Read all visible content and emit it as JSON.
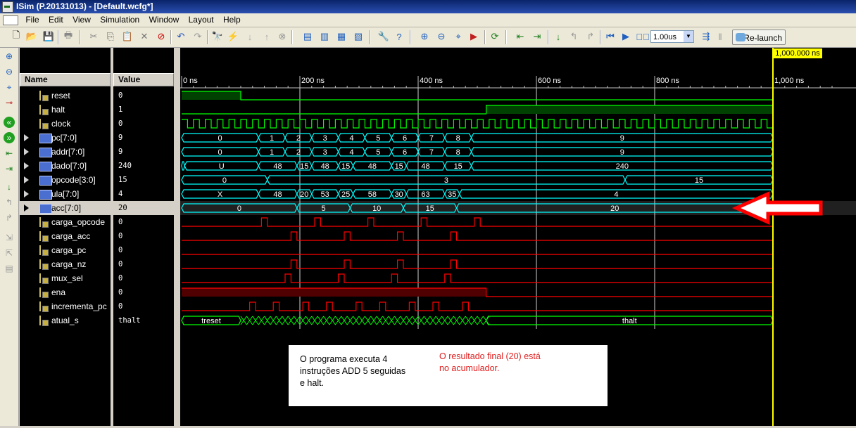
{
  "window": {
    "title": "ISim (P.20131013) - [Default.wcfg*]"
  },
  "menu": [
    "File",
    "Edit",
    "View",
    "Simulation",
    "Window",
    "Layout",
    "Help"
  ],
  "toolbar": {
    "run_time": "1.00us",
    "relaunch_label": "Re-launch"
  },
  "columns": {
    "name": "Name",
    "value": "Value"
  },
  "signals": [
    {
      "name": "reset",
      "value": "0",
      "kind": "bit",
      "expand": false
    },
    {
      "name": "halt",
      "value": "1",
      "kind": "bit",
      "expand": false
    },
    {
      "name": "clock",
      "value": "0",
      "kind": "bit",
      "expand": false
    },
    {
      "name": "pc[7:0]",
      "value": "9",
      "kind": "bus",
      "expand": true
    },
    {
      "name": "addr[7:0]",
      "value": "9",
      "kind": "bus",
      "expand": true
    },
    {
      "name": "dado[7:0]",
      "value": "240",
      "kind": "bus",
      "expand": true
    },
    {
      "name": "opcode[3:0]",
      "value": "15",
      "kind": "bus",
      "expand": true
    },
    {
      "name": "ula[7:0]",
      "value": "4",
      "kind": "bus",
      "expand": true
    },
    {
      "name": "acc[7:0]",
      "value": "20",
      "kind": "bus",
      "expand": true,
      "selected": true
    },
    {
      "name": "carga_opcode",
      "value": "0",
      "kind": "bit",
      "expand": false
    },
    {
      "name": "carga_acc",
      "value": "0",
      "kind": "bit",
      "expand": false
    },
    {
      "name": "carga_pc",
      "value": "0",
      "kind": "bit",
      "expand": false
    },
    {
      "name": "carga_nz",
      "value": "0",
      "kind": "bit",
      "expand": false
    },
    {
      "name": "mux_sel",
      "value": "0",
      "kind": "bit",
      "expand": false
    },
    {
      "name": "ena",
      "value": "0",
      "kind": "bit",
      "expand": false
    },
    {
      "name": "incrementa_pc",
      "value": "0",
      "kind": "bit",
      "expand": false
    },
    {
      "name": "atual_s",
      "value": "thalt",
      "kind": "bus",
      "expand": false
    }
  ],
  "timeline": {
    "ticks": [
      "0 ns",
      "200 ns",
      "400 ns",
      "600 ns",
      "800 ns",
      "1,000 ns"
    ],
    "cursor_label": "1,000.000 ns"
  },
  "waveforms": {
    "pc": [
      "0",
      "1",
      "2",
      "3",
      "4",
      "5",
      "6",
      "7",
      "8",
      "9"
    ],
    "addr": [
      "0",
      "1",
      "2",
      "3",
      "4",
      "5",
      "6",
      "7",
      "8",
      "9"
    ],
    "dado": [
      "U",
      "48",
      "15",
      "48",
      "15",
      "48",
      "15",
      "48",
      "15",
      "240"
    ],
    "opcode": [
      "0",
      "3",
      "15"
    ],
    "ula": [
      "X",
      "48",
      "20",
      "53",
      "25",
      "58",
      "30",
      "63",
      "35",
      "4"
    ],
    "acc": [
      "0",
      "5",
      "10",
      "15",
      "20"
    ],
    "atual_s": [
      "treset",
      "thalt"
    ]
  },
  "annotation": {
    "left_text": "O programa executa 4 instruções ADD 5 seguidas e halt.",
    "right_text": "O resultado final (20) está no acumulador."
  },
  "colors": {
    "bit_wave": "#00ff00",
    "bus_wave": "#00ffff",
    "control_wave": "#ff0000",
    "cursor": "#ffff00",
    "arrow": "#ff0000"
  }
}
